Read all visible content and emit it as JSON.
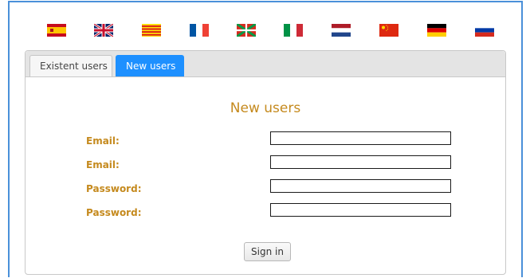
{
  "languages": [
    {
      "code": "es",
      "icon": "spain-flag-icon"
    },
    {
      "code": "en",
      "icon": "uk-flag-icon"
    },
    {
      "code": "ca",
      "icon": "catalonia-flag-icon"
    },
    {
      "code": "fr",
      "icon": "france-flag-icon"
    },
    {
      "code": "eu",
      "icon": "basque-flag-icon"
    },
    {
      "code": "it",
      "icon": "italy-flag-icon"
    },
    {
      "code": "nl",
      "icon": "netherlands-flag-icon"
    },
    {
      "code": "zh",
      "icon": "china-flag-icon"
    },
    {
      "code": "de",
      "icon": "germany-flag-icon"
    },
    {
      "code": "ru",
      "icon": "russia-flag-icon"
    }
  ],
  "tabs": {
    "existent": "Existent users",
    "new": "New users",
    "active": "new"
  },
  "form": {
    "title": "New users",
    "fields": [
      {
        "label": "Email:",
        "type": "text",
        "value": ""
      },
      {
        "label": "Email:",
        "type": "text",
        "value": ""
      },
      {
        "label": "Password:",
        "type": "password",
        "value": ""
      },
      {
        "label": "Password:",
        "type": "password",
        "value": ""
      }
    ],
    "submit_label": "Sign in"
  },
  "colors": {
    "accent": "#1e90ff",
    "label": "#c58a1e",
    "frame": "#4a90d9"
  }
}
